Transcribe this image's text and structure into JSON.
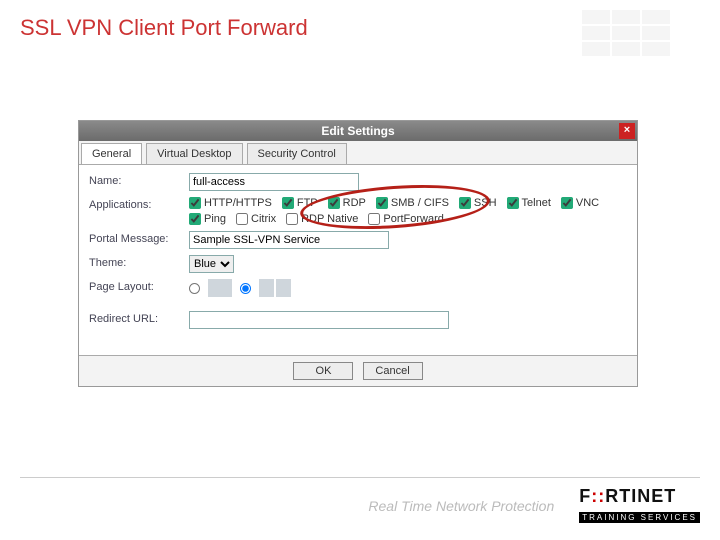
{
  "page": {
    "title": "SSL VPN Client Port Forward"
  },
  "dialog": {
    "title": "Edit Settings",
    "tabs": [
      {
        "label": "General",
        "active": true
      },
      {
        "label": "Virtual Desktop",
        "active": false
      },
      {
        "label": "Security Control",
        "active": false
      }
    ],
    "form": {
      "name": {
        "label": "Name:",
        "value": "full-access"
      },
      "applications": {
        "label": "Applications:",
        "options": [
          {
            "label": "HTTP/HTTPS",
            "checked": true
          },
          {
            "label": "FTP",
            "checked": true
          },
          {
            "label": "RDP",
            "checked": true
          },
          {
            "label": "SMB / CIFS",
            "checked": true
          },
          {
            "label": "SSH",
            "checked": true
          },
          {
            "label": "Telnet",
            "checked": true
          },
          {
            "label": "VNC",
            "checked": true
          },
          {
            "label": "Ping",
            "checked": true
          },
          {
            "label": "Citrix",
            "checked": false
          },
          {
            "label": "RDP Native",
            "checked": false
          },
          {
            "label": "PortForward",
            "checked": false
          }
        ]
      },
      "portal_message": {
        "label": "Portal Message:",
        "value": "Sample SSL-VPN Service"
      },
      "theme": {
        "label": "Theme:",
        "value": "Blue"
      },
      "page_layout": {
        "label": "Page Layout:",
        "selected": 1
      },
      "redirect_url": {
        "label": "Redirect URL:",
        "value": ""
      }
    },
    "buttons": {
      "ok": "OK",
      "cancel": "Cancel"
    }
  },
  "footer": {
    "tagline": "Real Time Network Protection",
    "brand": "FORTINET",
    "brand_sub": "TRAINING SERVICES"
  }
}
